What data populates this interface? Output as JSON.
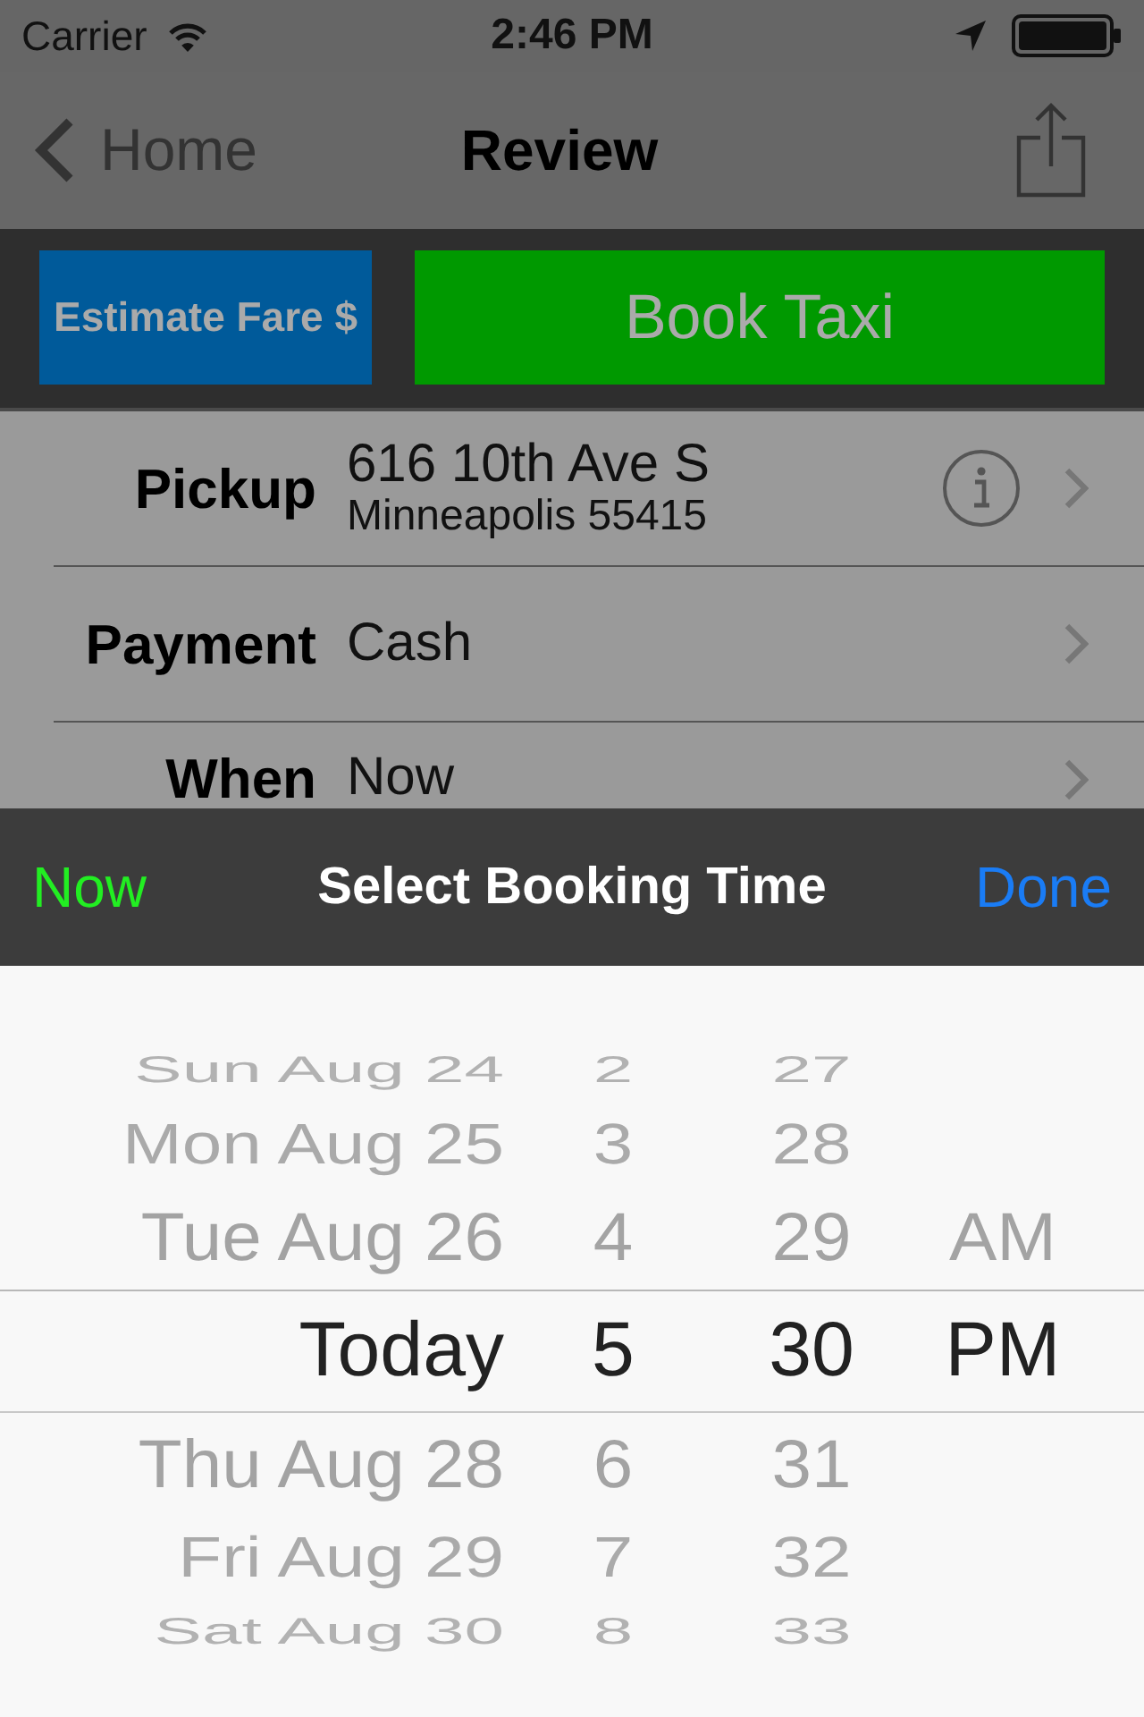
{
  "status_bar": {
    "carrier": "Carrier",
    "time": "2:46 PM"
  },
  "nav_bar": {
    "back_label": "Home",
    "title": "Review"
  },
  "action_buttons": [
    {
      "label": "Estimate Fare $",
      "kind": "secondary",
      "color": "#005a9a"
    },
    {
      "label": "Book Taxi",
      "kind": "primary",
      "color": "#009900"
    }
  ],
  "form_rows": [
    {
      "label": "Pickup",
      "value": "616 10th Ave S",
      "detail": "Minneapolis 55415",
      "info": true
    },
    {
      "label": "Payment",
      "value": "Cash",
      "info": false
    },
    {
      "label": "When",
      "value": "Now",
      "info": false
    }
  ],
  "picker_toolbar": {
    "left_button": "Now",
    "title": "Select Booking Time",
    "right_button": "Done"
  },
  "picker": {
    "columns": [
      {
        "kind": "day",
        "items": [
          {
            "label": "Sun Aug 24",
            "selected": false
          },
          {
            "label": "Mon Aug 25",
            "selected": false
          },
          {
            "label": "Tue Aug 26",
            "selected": false
          },
          {
            "label": "Today",
            "selected": true
          },
          {
            "label": "Thu Aug 28",
            "selected": false
          },
          {
            "label": "Fri Aug 29",
            "selected": false
          },
          {
            "label": "Sat Aug 30",
            "selected": false
          }
        ]
      },
      {
        "kind": "hour",
        "items": [
          {
            "label": "2",
            "selected": false
          },
          {
            "label": "3",
            "selected": false
          },
          {
            "label": "4",
            "selected": false
          },
          {
            "label": "5",
            "selected": true
          },
          {
            "label": "6",
            "selected": false
          },
          {
            "label": "7",
            "selected": false
          },
          {
            "label": "8",
            "selected": false
          }
        ]
      },
      {
        "kind": "minute",
        "items": [
          {
            "label": "27",
            "selected": false
          },
          {
            "label": "28",
            "selected": false
          },
          {
            "label": "29",
            "selected": false
          },
          {
            "label": "30",
            "selected": true
          },
          {
            "label": "31",
            "selected": false
          },
          {
            "label": "32",
            "selected": false
          },
          {
            "label": "33",
            "selected": false
          }
        ]
      },
      {
        "kind": "period",
        "items": [
          {
            "label": "AM",
            "selected": false
          },
          {
            "label": "PM",
            "selected": true
          }
        ]
      }
    ]
  }
}
